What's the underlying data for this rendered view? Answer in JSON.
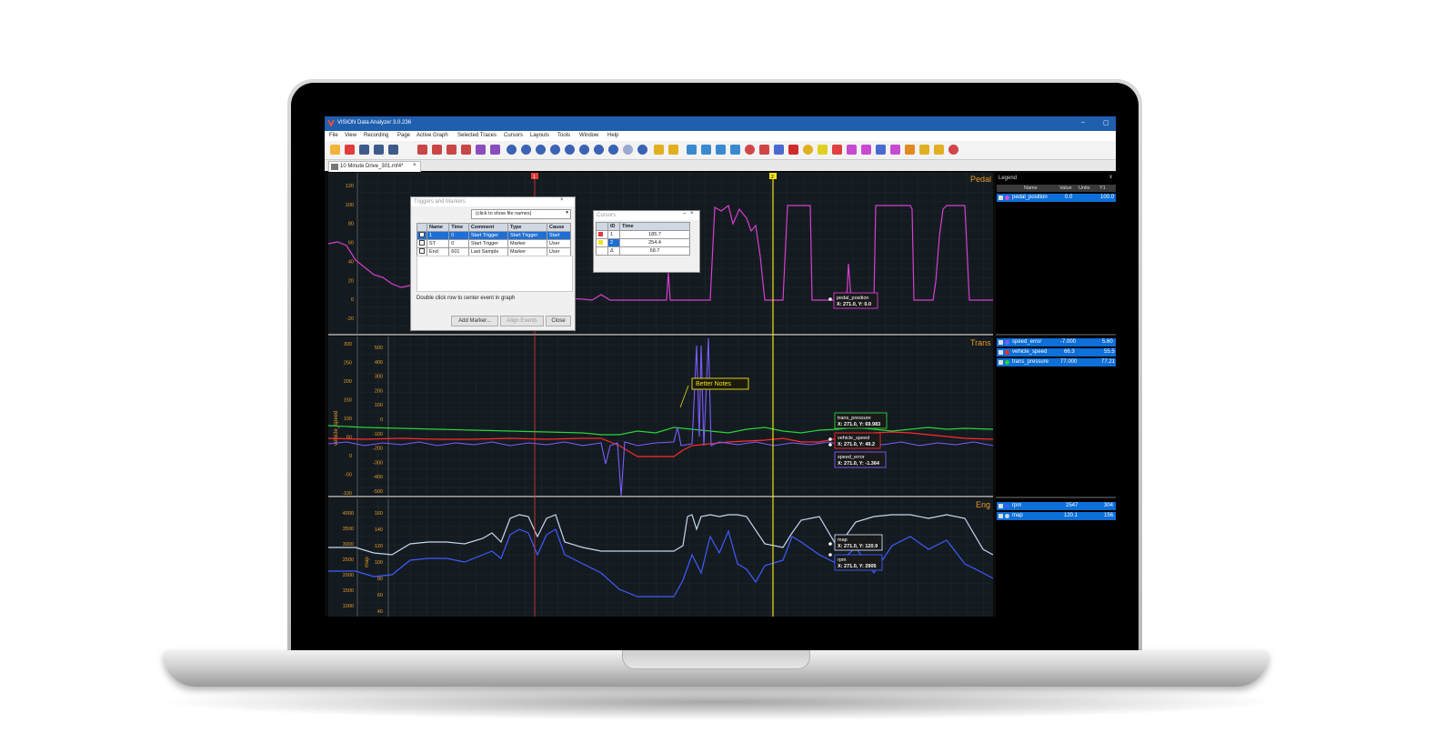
{
  "app": {
    "title": "VISION Data Analyzer 3.0.236",
    "menu": [
      "File",
      "View",
      "Recording",
      "Page",
      "Active Graph",
      "Selected Traces",
      "Cursors",
      "Layouts",
      "Tools",
      "Window",
      "Help"
    ],
    "tab_label": "10 Minute Drive_301.mf4*",
    "tab_close": "×"
  },
  "panes": {
    "pedal": {
      "label": "Pedal",
      "y_ticks": [
        "120",
        "100",
        "80",
        "60",
        "40",
        "20",
        "0",
        "-20"
      ],
      "tooltip": {
        "name": "pedal_position",
        "value": "X: 271.0,  Y: 0.0"
      }
    },
    "trans": {
      "label": "Trans",
      "y_ticks_left": [
        "300",
        "250",
        "200",
        "150",
        "100",
        "50",
        "0",
        "-50",
        "-100"
      ],
      "y_ticks_inner": [
        "500",
        "400",
        "300",
        "200",
        "100",
        "0",
        "-100",
        "-200",
        "-300",
        "-400",
        "-500"
      ],
      "y_axis_name": "vehicle_speed",
      "annotation": "Better Notes",
      "tooltips": [
        {
          "name": "trans_pressure",
          "value": "X: 271.0,  Y: 69.983"
        },
        {
          "name": "vehicle_speed",
          "value": "X: 271.0,  Y: 49.2"
        },
        {
          "name": "speed_error",
          "value": "X: 271.0,  Y: -1.364"
        }
      ]
    },
    "eng": {
      "label": "Eng",
      "y_ticks_left": [
        "4000",
        "3500",
        "3000",
        "2500",
        "2000",
        "1500",
        "1000"
      ],
      "y_ticks_inner": [
        "160",
        "140",
        "120",
        "100",
        "80",
        "60",
        "40"
      ],
      "y_axis_name": "map",
      "tooltips": [
        {
          "name": "map",
          "value": "X: 271.0,  Y: 120.9"
        },
        {
          "name": "rpm",
          "value": "X: 271.0,  Y: 2905"
        }
      ]
    }
  },
  "cursor_markers": {
    "red": "1",
    "yellow": "2"
  },
  "legend": {
    "title": "Legend",
    "close": "x",
    "columns": [
      "Name",
      "Value",
      "Units",
      "Y1"
    ],
    "pedal_rows": [
      {
        "name": "pedal_position",
        "value": "0.0",
        "units": "",
        "y1": "100.0",
        "color": "#e24ad6"
      }
    ],
    "trans_rows": [
      {
        "name": "speed_error",
        "value": "-7.000",
        "y1": "5.60",
        "color": "#7b5cff"
      },
      {
        "name": "vehicle_speed",
        "value": "66.3",
        "y1": "55.5",
        "color": "#ff2a2a"
      },
      {
        "name": "trans_pressure",
        "value": "77.000",
        "y1": "77.21",
        "color": "#2bd23a"
      }
    ],
    "eng_rows": [
      {
        "name": "rpm",
        "value": "2547",
        "y1": "304",
        "color": "#3f5bff"
      },
      {
        "name": "map",
        "value": "120.1",
        "y1": "156.",
        "color": "#c7d6ef"
      }
    ]
  },
  "triggers_dialog": {
    "title": "Triggers and Markers",
    "file_dropdown": "(click to show file names)",
    "columns": [
      "Name",
      "Time",
      "Comment",
      "Type",
      "Cause"
    ],
    "rows": [
      {
        "name": "1",
        "time": "0",
        "comment": "Start Trigger",
        "type": "Start Trigger",
        "cause": "Start"
      },
      {
        "name": "ST",
        "time": "0",
        "comment": "Start Trigger",
        "type": "Marker",
        "cause": "User"
      },
      {
        "name": "End",
        "time": "601",
        "comment": "Last Sample",
        "type": "Marker",
        "cause": "User"
      }
    ],
    "hint": "Double click row to center event in graph",
    "buttons": {
      "add": "Add Marker...",
      "align": "Align Events",
      "close": "Close"
    }
  },
  "cursors_dialog": {
    "title": "Cursors",
    "columns": [
      "ID",
      "Time"
    ],
    "rows": [
      {
        "id": "1",
        "time": "185.7"
      },
      {
        "id": "2",
        "time": "254.4"
      },
      {
        "id": "Δ",
        "time": "68.7"
      }
    ]
  },
  "colors": {
    "pedal": "#d63fcf",
    "speed_error": "#7b5cff",
    "vehicle_speed": "#ff2a2a",
    "trans_pressure": "#2bd23a",
    "rpm": "#3f5bff",
    "map": "#c7d6ef",
    "axis_label": "#e89a2a",
    "cursor_red": "#e23b3b",
    "cursor_yellow": "#f2e31a",
    "titlebar": "#1f5fae"
  }
}
